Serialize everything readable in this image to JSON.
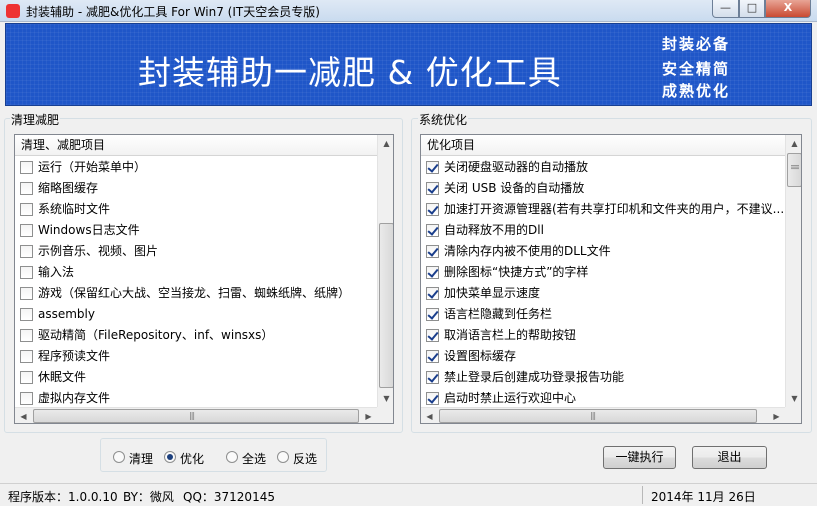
{
  "window": {
    "title": "封装辅助 - 减肥&优化工具 For Win7 (IT天空会员专版)",
    "minimize": "—",
    "maximize": "□",
    "close": "X"
  },
  "banner": {
    "title": "封装辅助一减肥 & 优化工具",
    "slogans": [
      "封装必备",
      "安全精简",
      "成熟优化"
    ]
  },
  "left_panel": {
    "group_label": "清理减肥",
    "header": "清理、减肥项目",
    "items": [
      {
        "label": "运行（开始菜单中）",
        "checked": false
      },
      {
        "label": "缩略图缓存",
        "checked": false
      },
      {
        "label": "系统临时文件",
        "checked": false
      },
      {
        "label": "Windows日志文件",
        "checked": false
      },
      {
        "label": "示例音乐、视频、图片",
        "checked": false
      },
      {
        "label": "输入法",
        "checked": false
      },
      {
        "label": "游戏（保留红心大战、空当接龙、扫雷、蜘蛛纸牌、纸牌）",
        "checked": false
      },
      {
        "label": "assembly",
        "checked": false
      },
      {
        "label": "驱动精简（FileRepository、inf、winsxs）",
        "checked": false
      },
      {
        "label": "程序预读文件",
        "checked": false
      },
      {
        "label": "休眠文件",
        "checked": false
      },
      {
        "label": "虚拟内存文件",
        "checked": false
      }
    ]
  },
  "right_panel": {
    "group_label": "系统优化",
    "header": "优化项目",
    "items": [
      {
        "label": "关闭硬盘驱动器的自动播放",
        "checked": true
      },
      {
        "label": "关闭 USB 设备的自动播放",
        "checked": true
      },
      {
        "label": "加速打开资源管理器(若有共享打印机和文件夹的用户，不建议...",
        "checked": true
      },
      {
        "label": "自动释放不用的Dll",
        "checked": true
      },
      {
        "label": "清除内存内被不使用的DLL文件",
        "checked": true
      },
      {
        "label": "删除图标“快捷方式”的字样",
        "checked": true
      },
      {
        "label": "加快菜单显示速度",
        "checked": true
      },
      {
        "label": "语言栏隐藏到任务栏",
        "checked": true
      },
      {
        "label": "取消语言栏上的帮助按钮",
        "checked": true
      },
      {
        "label": "设置图标缓存",
        "checked": true
      },
      {
        "label": "禁止登录后创建成功登录报告功能",
        "checked": true
      },
      {
        "label": "启动时禁止运行欢迎中心",
        "checked": true
      }
    ]
  },
  "mode": {
    "options": [
      {
        "label": "清理",
        "selected": false
      },
      {
        "label": "优化",
        "selected": true
      },
      {
        "label": "全选",
        "selected": false
      },
      {
        "label": "反选",
        "selected": false
      }
    ]
  },
  "buttons": {
    "execute": "一键执行",
    "exit": "退出"
  },
  "status": {
    "version": "程序版本：1.0.0.10",
    "author": "BY：微风",
    "qq": "QQ：37120145",
    "date": "2014年 11月 26日"
  }
}
